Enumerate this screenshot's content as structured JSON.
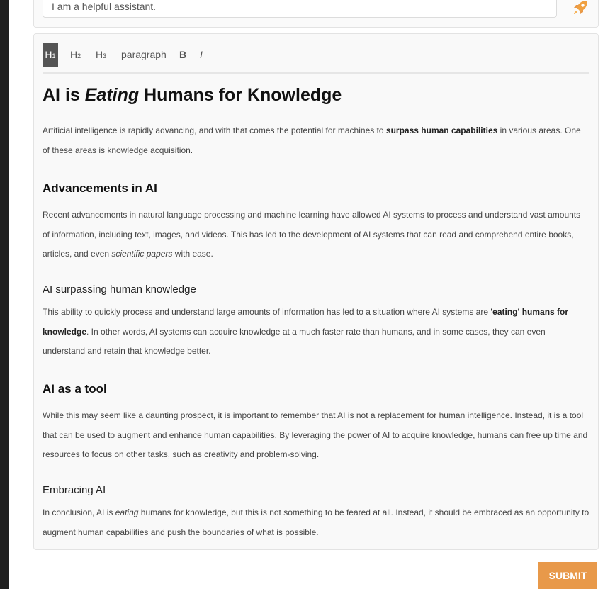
{
  "system_prompt": {
    "value": "I am a helpful assistant."
  },
  "toolbar": {
    "h1": "H",
    "h1_sub": "1",
    "h2": "H",
    "h2_sub": "2",
    "h3": "H",
    "h3_sub": "3",
    "paragraph": "paragraph",
    "bold": "B",
    "italic": "I"
  },
  "document": {
    "title_a": "AI is ",
    "title_b": "Eating",
    "title_c": " Humans for Knowledge",
    "intro_a": "Artificial intelligence is rapidly advancing, and with that comes the potential for machines to ",
    "intro_b": "surpass human capabilities",
    "intro_c": " in various areas. One of these areas is knowledge acquisition.",
    "h2_advancements": "Advancements in AI",
    "adv_a": "Recent advancements in natural language processing and machine learning have allowed AI systems to process and understand vast amounts of information, including text, images, and videos. This has led to the development of AI systems that can read and comprehend entire books, articles, and even ",
    "adv_b": "scientific papers",
    "adv_c": " with ease.",
    "h3_surpassing": "AI surpassing human knowledge",
    "surp_a": "This ability to quickly process and understand large amounts of information has led to a situation where AI systems are ",
    "surp_b": "'eating' humans for knowledge",
    "surp_c": ". In other words, AI systems can acquire knowledge at a much faster rate than humans, and in some cases, they can even understand and retain that knowledge better.",
    "h2_tool": "AI as a tool",
    "tool_p": "While this may seem like a daunting prospect, it is important to remember that AI is not a replacement for human intelligence. Instead, it is a tool that can be used to augment and enhance human capabilities. By leveraging the power of AI to acquire knowledge, humans can free up time and resources to focus on other tasks, such as creativity and problem-solving.",
    "h3_embracing": "Embracing AI",
    "emb_a": "In conclusion, AI is ",
    "emb_b": "eating",
    "emb_c": " humans for knowledge, but this is not something to be feared at all. Instead, it should be embraced as an opportunity to augment human capabilities and push the boundaries of what is possible."
  },
  "submit_label": "SUBMIT",
  "colors": {
    "accent": "#e8994a",
    "active_tool": "#555555"
  },
  "icons": {
    "send": "rocket-icon"
  }
}
